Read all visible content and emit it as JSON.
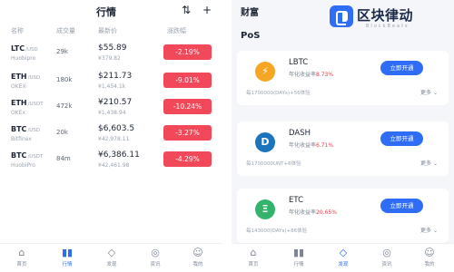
{
  "left": {
    "title": "行情",
    "columns": {
      "name": "名称",
      "volume": "成交量",
      "price": "最新价",
      "change": "涨跌幅"
    },
    "rows": [
      {
        "coin": "LTC",
        "pair": "/USD",
        "exchange": "Huobipro",
        "volume": "29k",
        "price": "$55.89",
        "cny": "¥379.82",
        "change": "-2.19%"
      },
      {
        "coin": "ETH",
        "pair": "/USD",
        "exchange": "OKEX",
        "volume": "180k",
        "price": "$211.73",
        "cny": "¥1,454.1k",
        "change": "-9.01%"
      },
      {
        "coin": "ETH",
        "pair": "/USDT",
        "exchange": "OKEx",
        "volume": "472k",
        "price": "¥210.57",
        "cny": "¥1,438.94",
        "change": "-10.24%"
      },
      {
        "coin": "BTC",
        "pair": "/USD",
        "exchange": "Bitfinex",
        "volume": "20k",
        "price": "$6,603.5",
        "cny": "¥42,978.11",
        "change": "-3.27%"
      },
      {
        "coin": "BTC",
        "pair": "/USDT",
        "exchange": "HuobiPro",
        "volume": "84m",
        "price": "¥6,386.11",
        "cny": "¥42,461.98",
        "change": "-4.29%"
      }
    ],
    "tabs": [
      {
        "label": "首页",
        "icon": "home-icon"
      },
      {
        "label": "行情",
        "icon": "chart-icon"
      },
      {
        "label": "发现",
        "icon": "diamond-icon"
      },
      {
        "label": "资讯",
        "icon": "compass-icon"
      },
      {
        "label": "我的",
        "icon": "person-icon"
      }
    ]
  },
  "right": {
    "title": "财富",
    "section": "PoS",
    "cards": [
      {
        "name": "LBTC",
        "rate_label": "年化收益率",
        "rate": "8.73%",
        "button": "立即开通",
        "foot": "每1700000(DAYs)+56体验",
        "more": "更多",
        "color": "#f5a623",
        "icon": "bolt-icon"
      },
      {
        "name": "DASH",
        "rate_label": "年化收益率",
        "rate": "6.71%",
        "button": "立即开通",
        "foot": "每1700000UNT+6体验",
        "more": "更多",
        "color": "#1c75bc",
        "icon": "dash-icon"
      },
      {
        "name": "ETC",
        "rate_label": "年化收益率",
        "rate": "20.65%",
        "button": "立即开通",
        "foot": "每143000(DAYs)+86体验",
        "more": "更多",
        "color": "#33b36b",
        "icon": "etc-icon"
      }
    ],
    "logo": {
      "text": "区块律动",
      "sub": "BlockBeats"
    }
  }
}
